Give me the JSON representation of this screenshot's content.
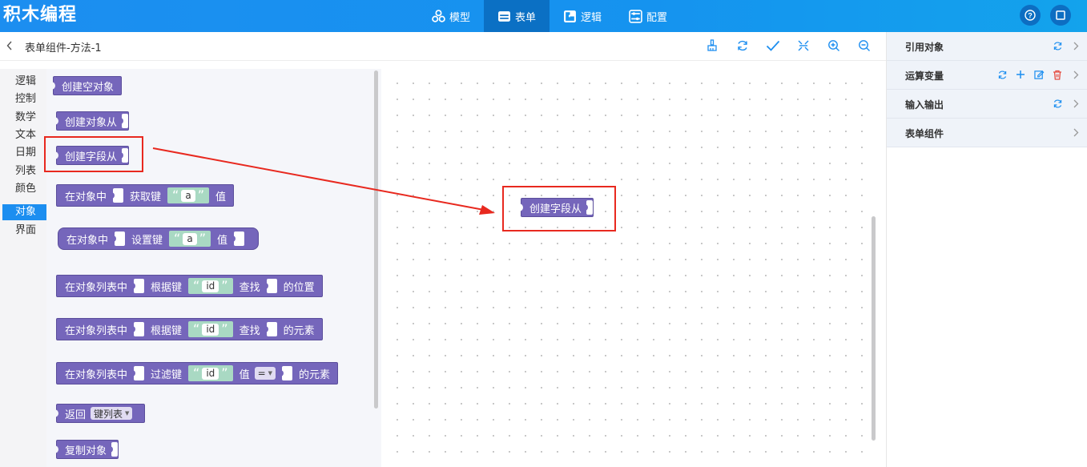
{
  "header": {
    "app_title": "积木编程",
    "nav": [
      {
        "label": "模型",
        "icon": "cubes-icon"
      },
      {
        "label": "表单",
        "icon": "form-icon",
        "active": true
      },
      {
        "label": "逻辑",
        "icon": "puzzle-icon"
      },
      {
        "label": "配置",
        "icon": "settings-sliders-icon"
      }
    ],
    "right_icons": [
      "help-icon",
      "fullscreen-icon"
    ]
  },
  "breadcrumb": {
    "title": "表单组件-方法-1"
  },
  "toolbar": [
    "brush-icon",
    "refresh-icon",
    "check-icon",
    "collapse-icon",
    "zoom-in-icon",
    "zoom-out-icon"
  ],
  "categories": [
    "逻辑",
    "控制",
    "数学",
    "文本",
    "日期",
    "列表",
    "颜色",
    "对象",
    "界面"
  ],
  "active_category": "对象",
  "blocks": {
    "create_empty": "创建空对象",
    "create_from": "创建对象从",
    "create_field_from": "创建字段从",
    "get_key": {
      "a": "在对象中",
      "b": "获取键",
      "str": "a",
      "c": "值"
    },
    "set_key": {
      "a": "在对象中",
      "b": "设置键",
      "str": "a",
      "c": "值"
    },
    "find_pos": {
      "a": "在对象列表中",
      "b": "根据键",
      "str": "id",
      "c": "查找",
      "d": "的位置"
    },
    "find_elem": {
      "a": "在对象列表中",
      "b": "根据键",
      "str": "id",
      "c": "查找",
      "d": "的元素"
    },
    "filter": {
      "a": "在对象列表中",
      "b": "过滤键",
      "str": "id",
      "c": "值",
      "op": "=",
      "d": "的元素"
    },
    "return_keys": {
      "a": "返回",
      "dropdown": "键列表"
    },
    "copy_obj": "复制对象",
    "quote_open": "“",
    "quote_close": "”"
  },
  "canvas": {
    "dragged_block": "创建字段从"
  },
  "right_panel": [
    {
      "label": "引用对象",
      "icons": [
        "refresh-icon",
        "chevron-right-icon"
      ]
    },
    {
      "label": "运算变量",
      "icons": [
        "refresh-icon",
        "plus-icon",
        "edit-icon",
        "delete-icon",
        "chevron-right-icon"
      ]
    },
    {
      "label": "输入输出",
      "icons": [
        "refresh-icon",
        "chevron-right-icon"
      ]
    },
    {
      "label": "表单组件",
      "icons": [
        "chevron-right-icon"
      ]
    }
  ],
  "colors": {
    "topbar": "#1c8ef0",
    "active_nav": "#0b70c4",
    "block": "#7566bb",
    "string_block": "#a9d9c3",
    "highlight": "#e8291f",
    "delete": "#e54d42"
  }
}
